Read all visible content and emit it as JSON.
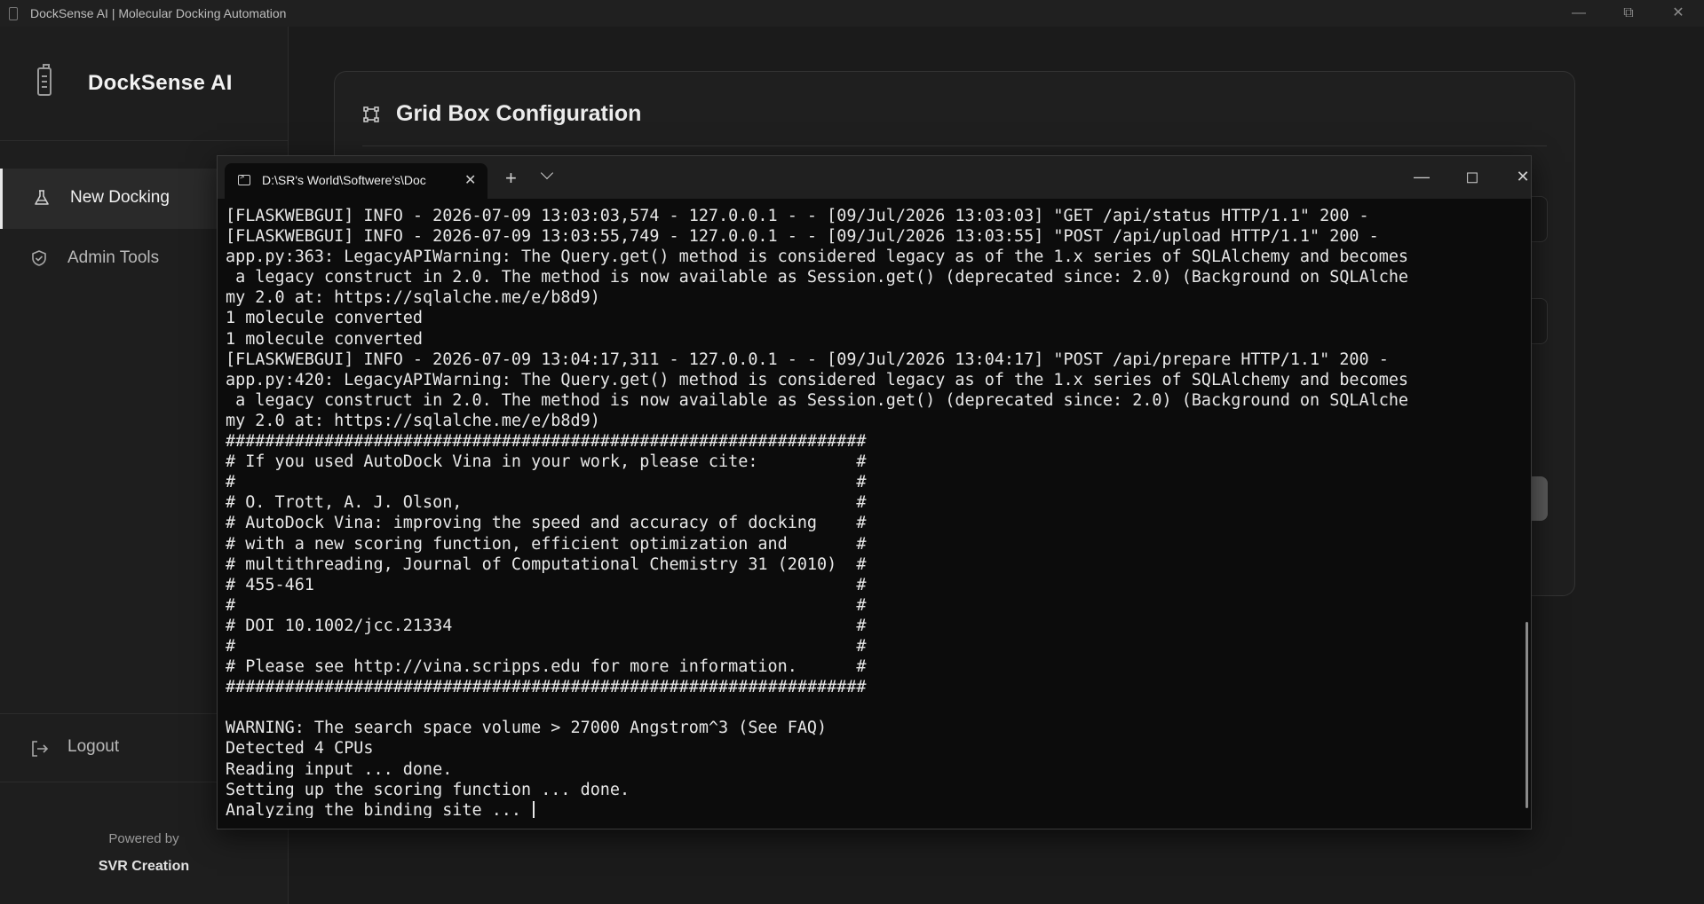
{
  "window": {
    "title": "DockSense AI | Molecular Docking Automation"
  },
  "sidebar": {
    "brand": "DockSense AI",
    "items": [
      {
        "label": "New Docking",
        "icon": "flask-icon",
        "active": true
      },
      {
        "label": "Admin Tools",
        "icon": "shield-check-icon",
        "active": false
      }
    ],
    "logout_label": "Logout",
    "powered_by": "Powered by",
    "creator": "SVR Creation"
  },
  "card": {
    "title": "Grid Box Configuration",
    "icon": "grid-box-icon"
  },
  "terminal": {
    "tab_title": "D:\\SR's World\\Softwere's\\Doc",
    "lines": [
      "[FLASKWEBGUI] INFO - 2026-07-09 13:03:03,574 - 127.0.0.1 - - [09/Jul/2026 13:03:03] \"GET /api/status HTTP/1.1\" 200 -",
      "[FLASKWEBGUI] INFO - 2026-07-09 13:03:55,749 - 127.0.0.1 - - [09/Jul/2026 13:03:55] \"POST /api/upload HTTP/1.1\" 200 -",
      "app.py:363: LegacyAPIWarning: The Query.get() method is considered legacy as of the 1.x series of SQLAlchemy and becomes",
      " a legacy construct in 2.0. The method is now available as Session.get() (deprecated since: 2.0) (Background on SQLAlche",
      "my 2.0 at: https://sqlalche.me/e/b8d9)",
      "1 molecule converted",
      "1 molecule converted",
      "[FLASKWEBGUI] INFO - 2026-07-09 13:04:17,311 - 127.0.0.1 - - [09/Jul/2026 13:04:17] \"POST /api/prepare HTTP/1.1\" 200 -",
      "app.py:420: LegacyAPIWarning: The Query.get() method is considered legacy as of the 1.x series of SQLAlchemy and becomes",
      " a legacy construct in 2.0. The method is now available as Session.get() (deprecated since: 2.0) (Background on SQLAlche",
      "my 2.0 at: https://sqlalche.me/e/b8d9)",
      "#################################################################",
      "# If you used AutoDock Vina in your work, please cite:          #",
      "#                                                               #",
      "# O. Trott, A. J. Olson,                                        #",
      "# AutoDock Vina: improving the speed and accuracy of docking    #",
      "# with a new scoring function, efficient optimization and       #",
      "# multithreading, Journal of Computational Chemistry 31 (2010)  #",
      "# 455-461                                                       #",
      "#                                                               #",
      "# DOI 10.1002/jcc.21334                                         #",
      "#                                                               #",
      "# Please see http://vina.scripps.edu for more information.      #",
      "#################################################################",
      "",
      "WARNING: The search space volume > 27000 Angstrom^3 (See FAQ)",
      "Detected 4 CPUs",
      "Reading input ... done.",
      "Setting up the scoring function ... done.",
      "Analyzing the binding site ... "
    ]
  }
}
